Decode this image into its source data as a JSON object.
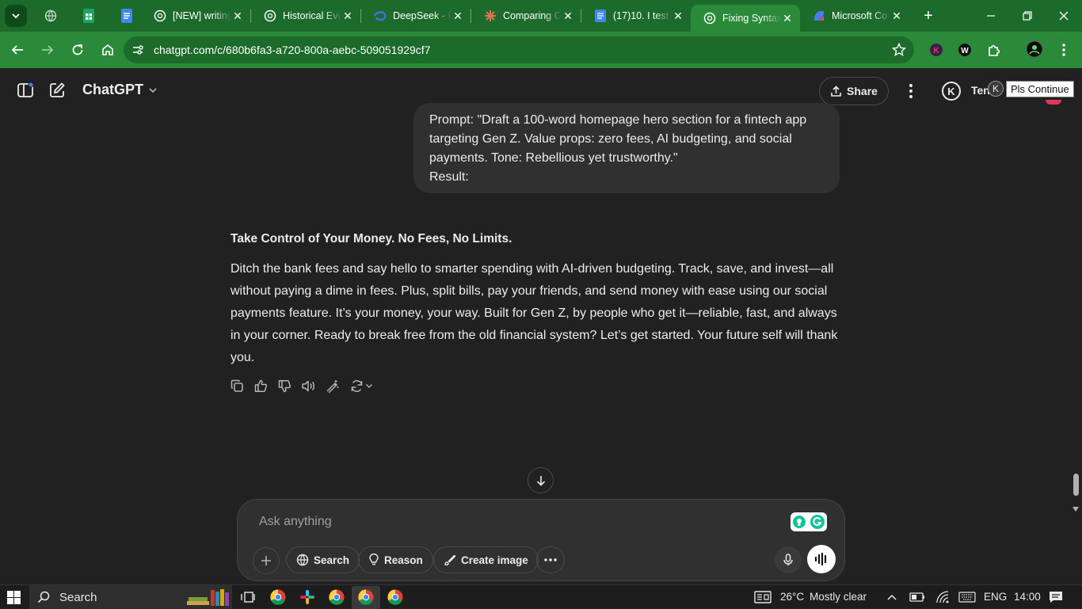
{
  "browser": {
    "tabs": [
      {
        "title": "",
        "icon": "globe-icon"
      },
      {
        "title": "",
        "icon": "google-sheets-icon"
      },
      {
        "title": "",
        "icon": "google-docs-icon"
      },
      {
        "title": "[NEW] writing",
        "icon": "chatgpt-icon"
      },
      {
        "title": "Historical Events",
        "icon": "chatgpt-icon"
      },
      {
        "title": "DeepSeek - I",
        "icon": "deepseek-icon"
      },
      {
        "title": "Comparing C",
        "icon": "claude-icon"
      },
      {
        "title": "(17)10. I test",
        "icon": "google-docs-icon"
      },
      {
        "title": "Fixing Syntax",
        "icon": "chatgpt-icon",
        "active": true
      },
      {
        "title": "Microsoft Co",
        "icon": "copilot-icon"
      }
    ],
    "close_glyph": "✕",
    "url": "chatgpt.com/c/680b6fa3-a720-800a-aebc-509051929cf7",
    "accent_color": "#2a8a3a"
  },
  "header": {
    "model_title": "ChatGPT",
    "share_label": "Share",
    "avatar_letter": "K",
    "user_name": "Ten",
    "tooltip": "Pls Continue"
  },
  "conversation": {
    "user_message": "Prompt: \"Draft a 100-word homepage hero section for a fintech app targeting Gen Z. Value props: zero fees, AI budgeting, and social payments. Tone: Rebellious yet trustworthy.\"\nResult:",
    "assistant_heading": "Take Control of Your Money. No Fees, No Limits.",
    "assistant_body": "Ditch the bank fees and say hello to smarter spending with AI-driven budgeting. Track, save, and invest—all without paying a dime in fees. Plus, split bills, pay your friends, and send money with ease using our social payments feature. It’s your money, your way. Built for Gen Z, by people who get it—reliable, fast, and always in your corner. Ready to break free from the old financial system? Let’s get started. Your future self will thank you."
  },
  "composer": {
    "placeholder": "Ask anything",
    "search_label": "Search",
    "reason_label": "Reason",
    "create_image_label": "Create image"
  },
  "taskbar": {
    "search_label": "Search",
    "temperature": "26°C",
    "weather": "Mostly clear",
    "language": "ENG",
    "time": "14:00"
  }
}
